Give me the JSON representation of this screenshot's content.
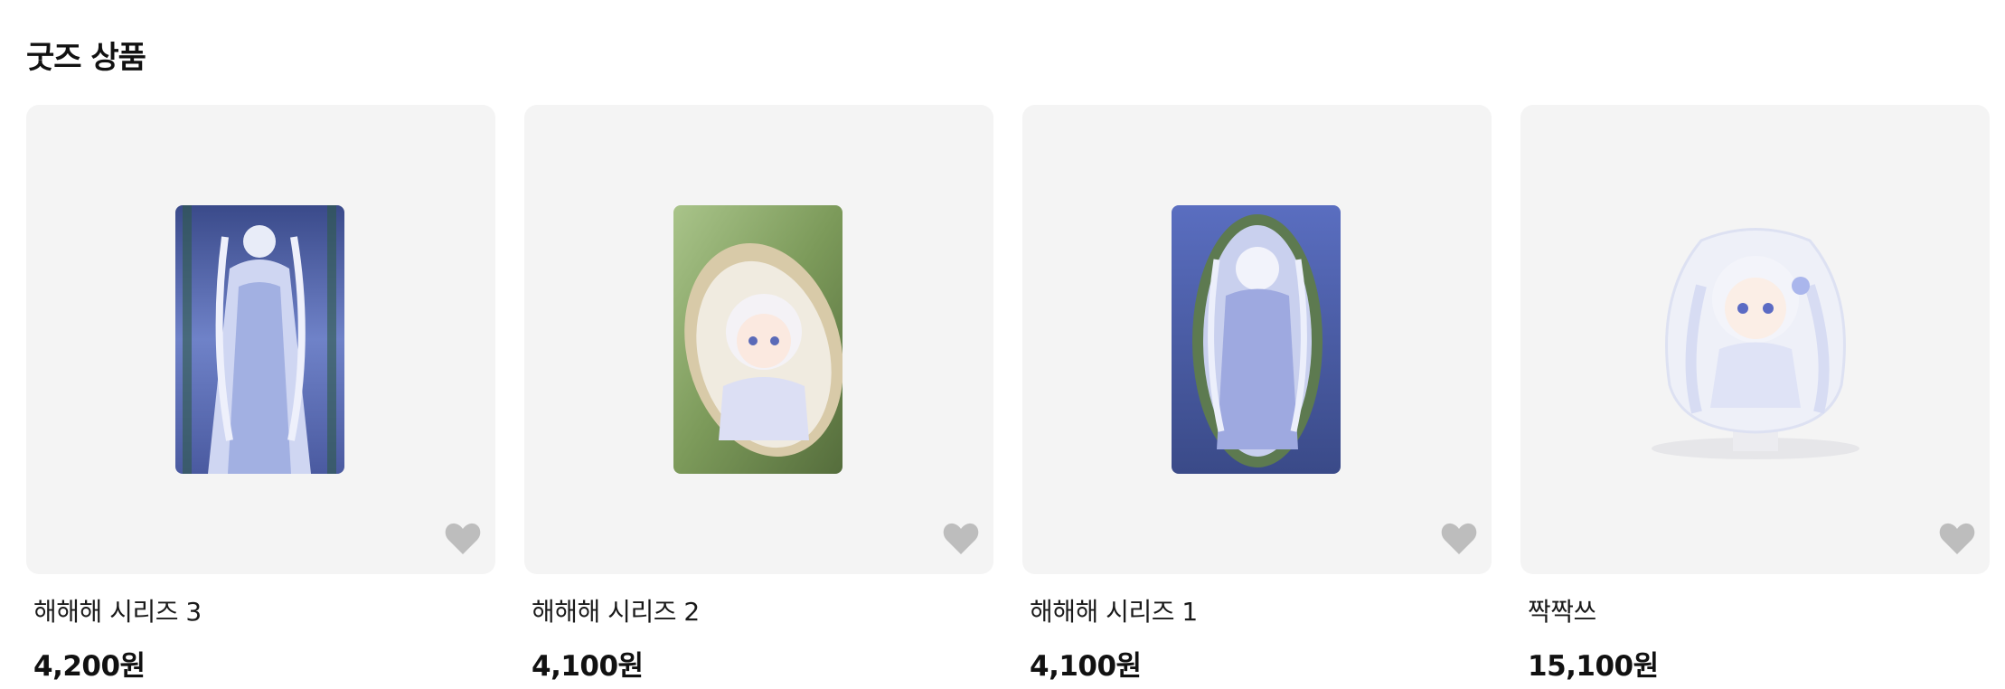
{
  "section": {
    "title": "굿즈 상품"
  },
  "products": [
    {
      "name": "해해해 시리즈 3",
      "price": "4,200원",
      "image": "card-standing-girl-bamboo"
    },
    {
      "name": "해해해 시리즈 2",
      "price": "4,100원",
      "image": "card-chibi-in-bamboo"
    },
    {
      "name": "해해해 시리즈 1",
      "price": "4,100원",
      "image": "card-girl-in-bamboo"
    },
    {
      "name": "짝짝쓰",
      "price": "15,100원",
      "image": "acrylic-stand-chibi"
    }
  ],
  "colors": {
    "card_bg": "#f4f4f4",
    "heart": "#bdbdbd",
    "text": "#111111"
  },
  "icons": {
    "wishlist": "heart-icon"
  }
}
